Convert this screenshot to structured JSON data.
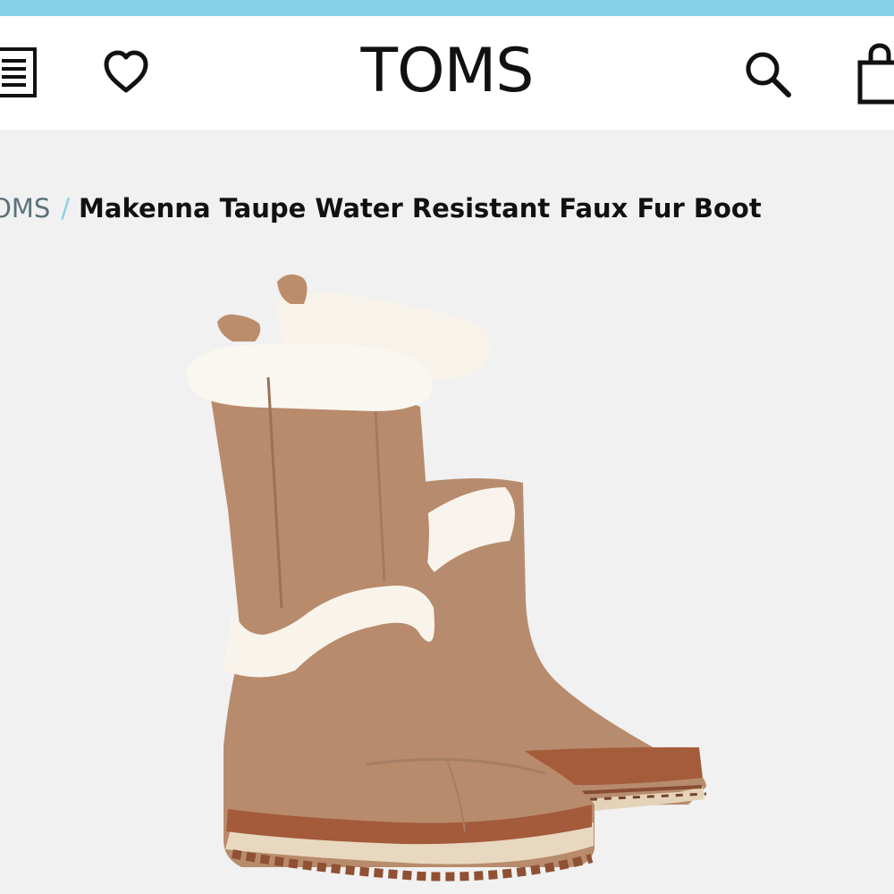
{
  "header": {
    "logo_text": "TOMS",
    "accent_color": "#86d0ea",
    "icons": [
      "menu-icon",
      "heart-icon",
      "search-icon",
      "shopping-bag-icon"
    ]
  },
  "breadcrumb": {
    "parent_label": "OMS",
    "separator": "/",
    "current_label": "Makenna Taupe Water Resistant Faux Fur Boot"
  },
  "product": {
    "image_subject": "boots"
  }
}
